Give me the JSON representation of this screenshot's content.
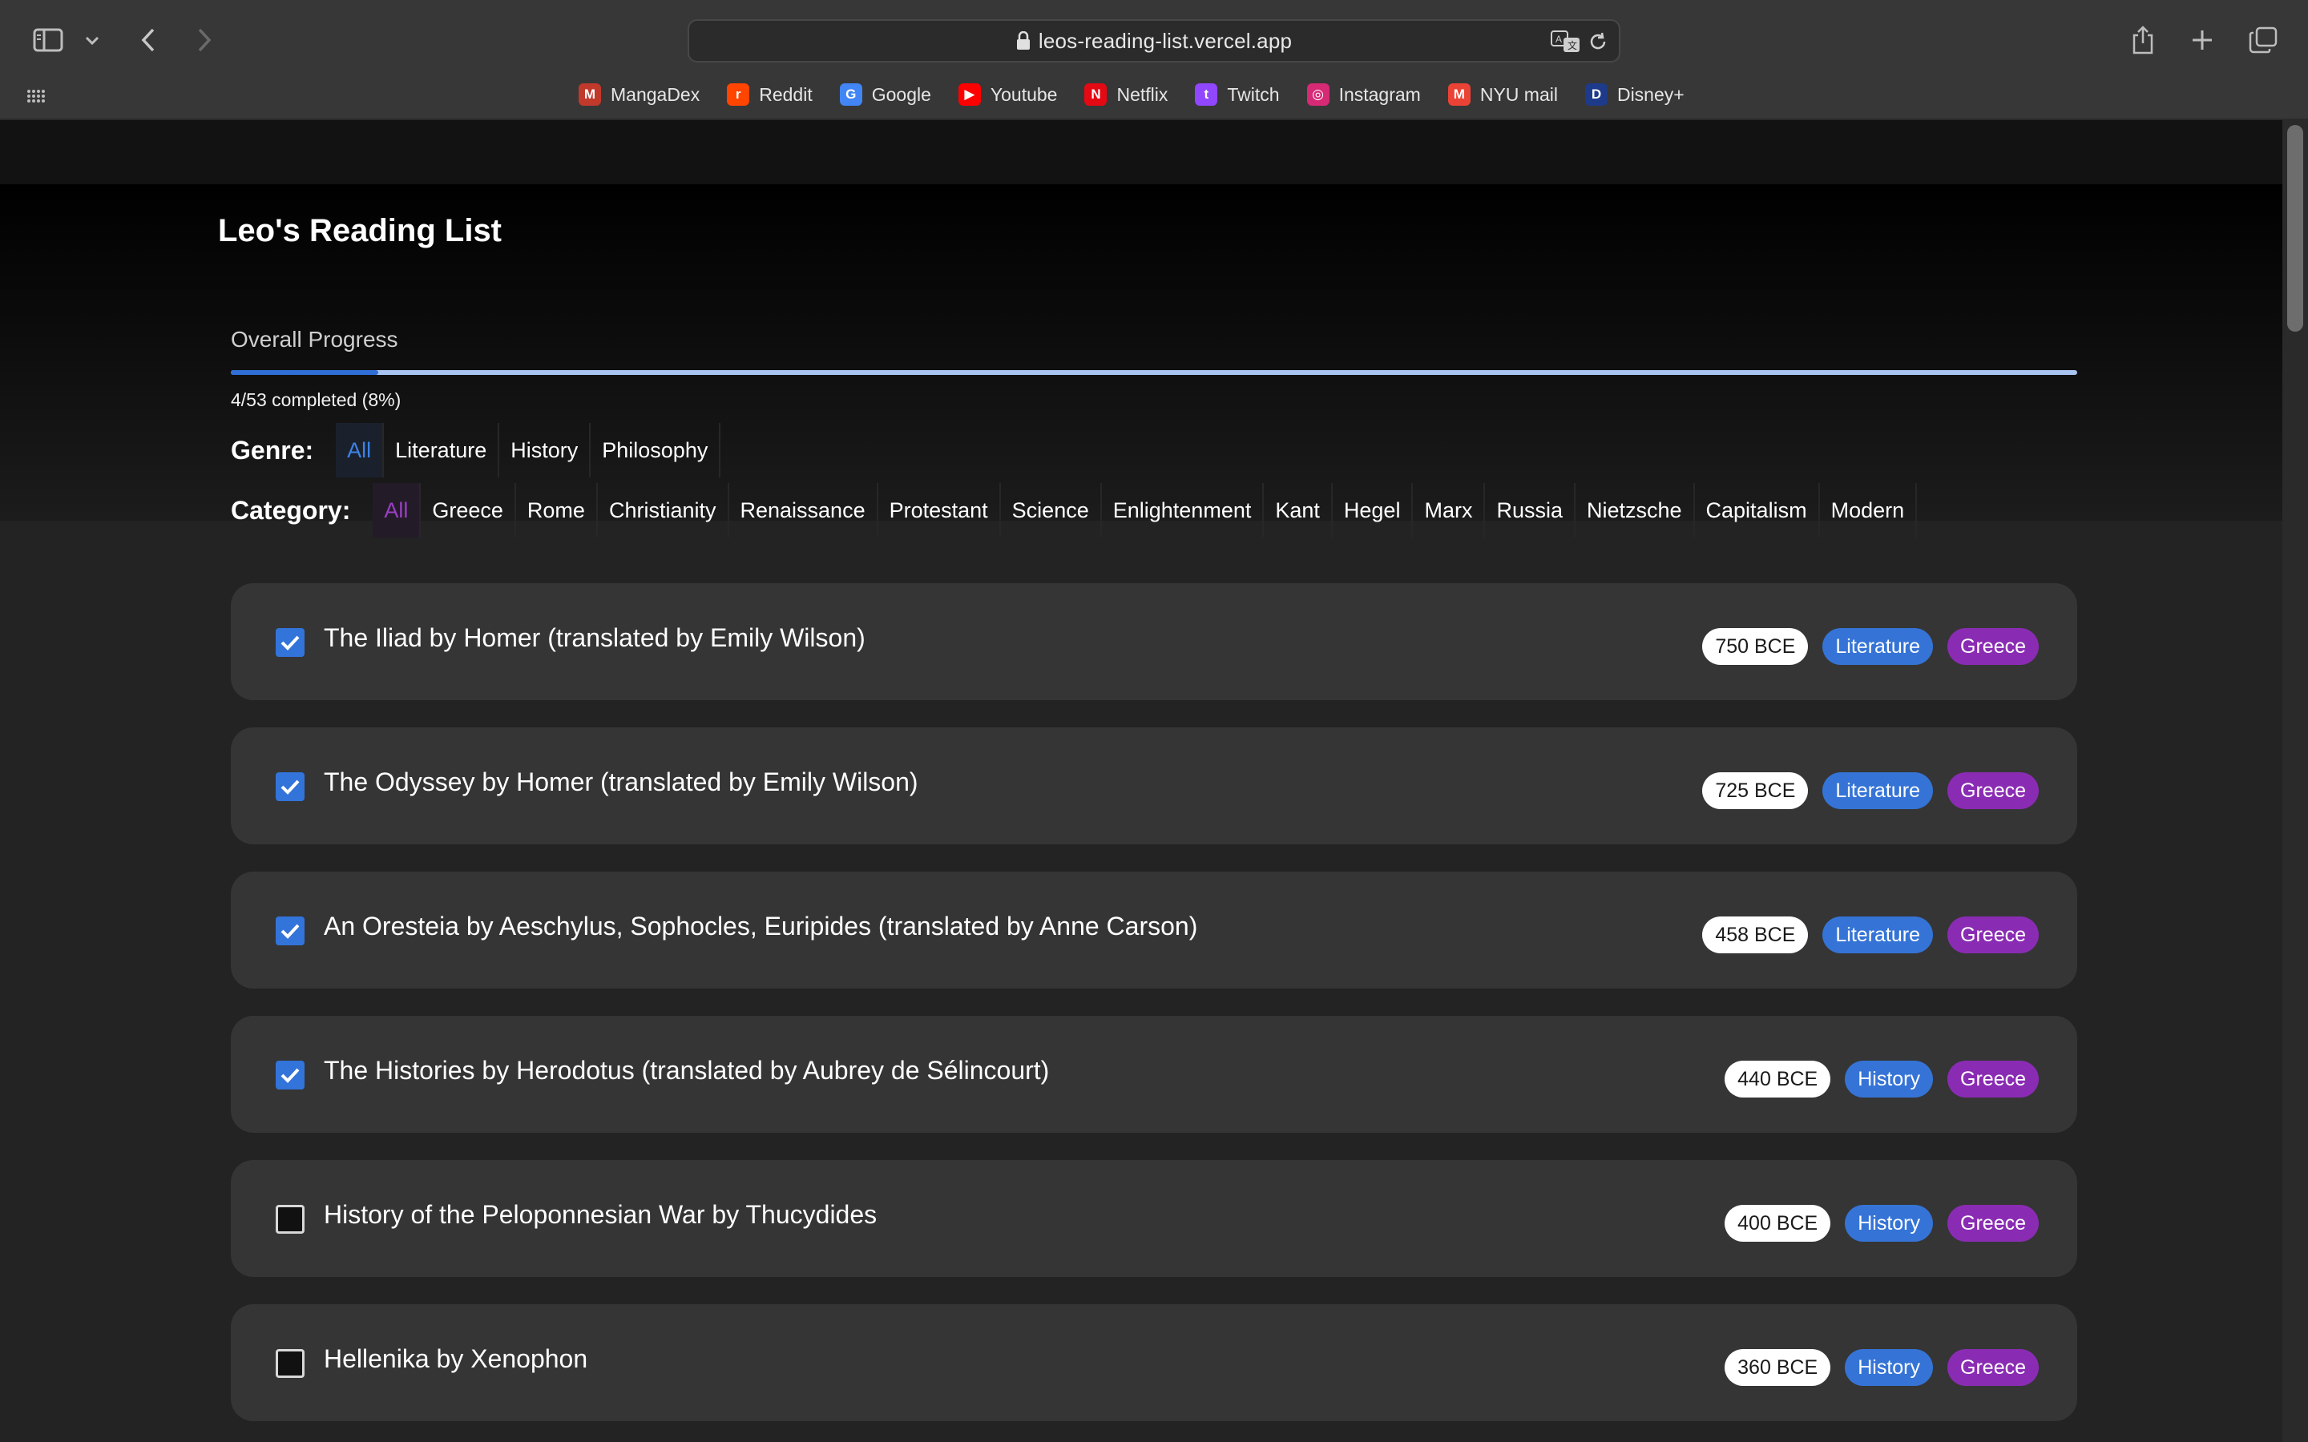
{
  "browser": {
    "url": "leos-reading-list.vercel.app",
    "bookmarks": [
      {
        "label": "MangaDex",
        "icon": "mangadex-icon",
        "color": "#c0392b",
        "glyph": "M"
      },
      {
        "label": "Reddit",
        "icon": "reddit-icon",
        "color": "#ff4500",
        "glyph": "r"
      },
      {
        "label": "Google",
        "icon": "google-icon",
        "color": "#4285f4",
        "glyph": "G"
      },
      {
        "label": "Youtube",
        "icon": "youtube-icon",
        "color": "#ff0000",
        "glyph": "▶"
      },
      {
        "label": "Netflix",
        "icon": "netflix-icon",
        "color": "#e50914",
        "glyph": "N"
      },
      {
        "label": "Twitch",
        "icon": "twitch-icon",
        "color": "#9146ff",
        "glyph": "t"
      },
      {
        "label": "Instagram",
        "icon": "instagram-icon",
        "color": "#d62976",
        "glyph": "◎"
      },
      {
        "label": "NYU mail",
        "icon": "gmail-icon",
        "color": "#ea4335",
        "glyph": "M"
      },
      {
        "label": "Disney+",
        "icon": "disney-plus-icon",
        "color": "#1e3a8a",
        "glyph": "D"
      }
    ]
  },
  "page": {
    "title": "Leo's Reading List",
    "progress": {
      "label": "Overall Progress",
      "completed": 4,
      "total": 53,
      "fraction": 0.08,
      "text": "4/53 completed (8%)"
    },
    "genre": {
      "label": "Genre:",
      "options": [
        "All",
        "Literature",
        "History",
        "Philosophy"
      ],
      "selected": "All"
    },
    "category": {
      "label": "Category:",
      "options": [
        "All",
        "Greece",
        "Rome",
        "Christianity",
        "Renaissance",
        "Protestant",
        "Science",
        "Enlightenment",
        "Kant",
        "Hegel",
        "Marx",
        "Russia",
        "Nietzsche",
        "Capitalism",
        "Modern"
      ],
      "selected": "All"
    },
    "books": [
      {
        "title": "The Iliad by Homer (translated by Emily Wilson)",
        "year": "750 BCE",
        "genre": "Literature",
        "category": "Greece",
        "done": true
      },
      {
        "title": "The Odyssey by Homer (translated by Emily Wilson)",
        "year": "725 BCE",
        "genre": "Literature",
        "category": "Greece",
        "done": true
      },
      {
        "title": "An Oresteia by Aeschylus, Sophocles, Euripides (translated by Anne Carson)",
        "year": "458 BCE",
        "genre": "Literature",
        "category": "Greece",
        "done": true
      },
      {
        "title": "The Histories by Herodotus (translated by Aubrey de Sélincourt)",
        "year": "440 BCE",
        "genre": "History",
        "category": "Greece",
        "done": true
      },
      {
        "title": "History of the Peloponnesian War by Thucydides",
        "year": "400 BCE",
        "genre": "History",
        "category": "Greece",
        "done": false
      },
      {
        "title": "Hellenika by Xenophon",
        "year": "360 BCE",
        "genre": "History",
        "category": "Greece",
        "done": false
      }
    ]
  },
  "colors": {
    "accent_blue": "#3574d6",
    "accent_purple": "#8a2cb3",
    "card_bg": "#353535"
  }
}
